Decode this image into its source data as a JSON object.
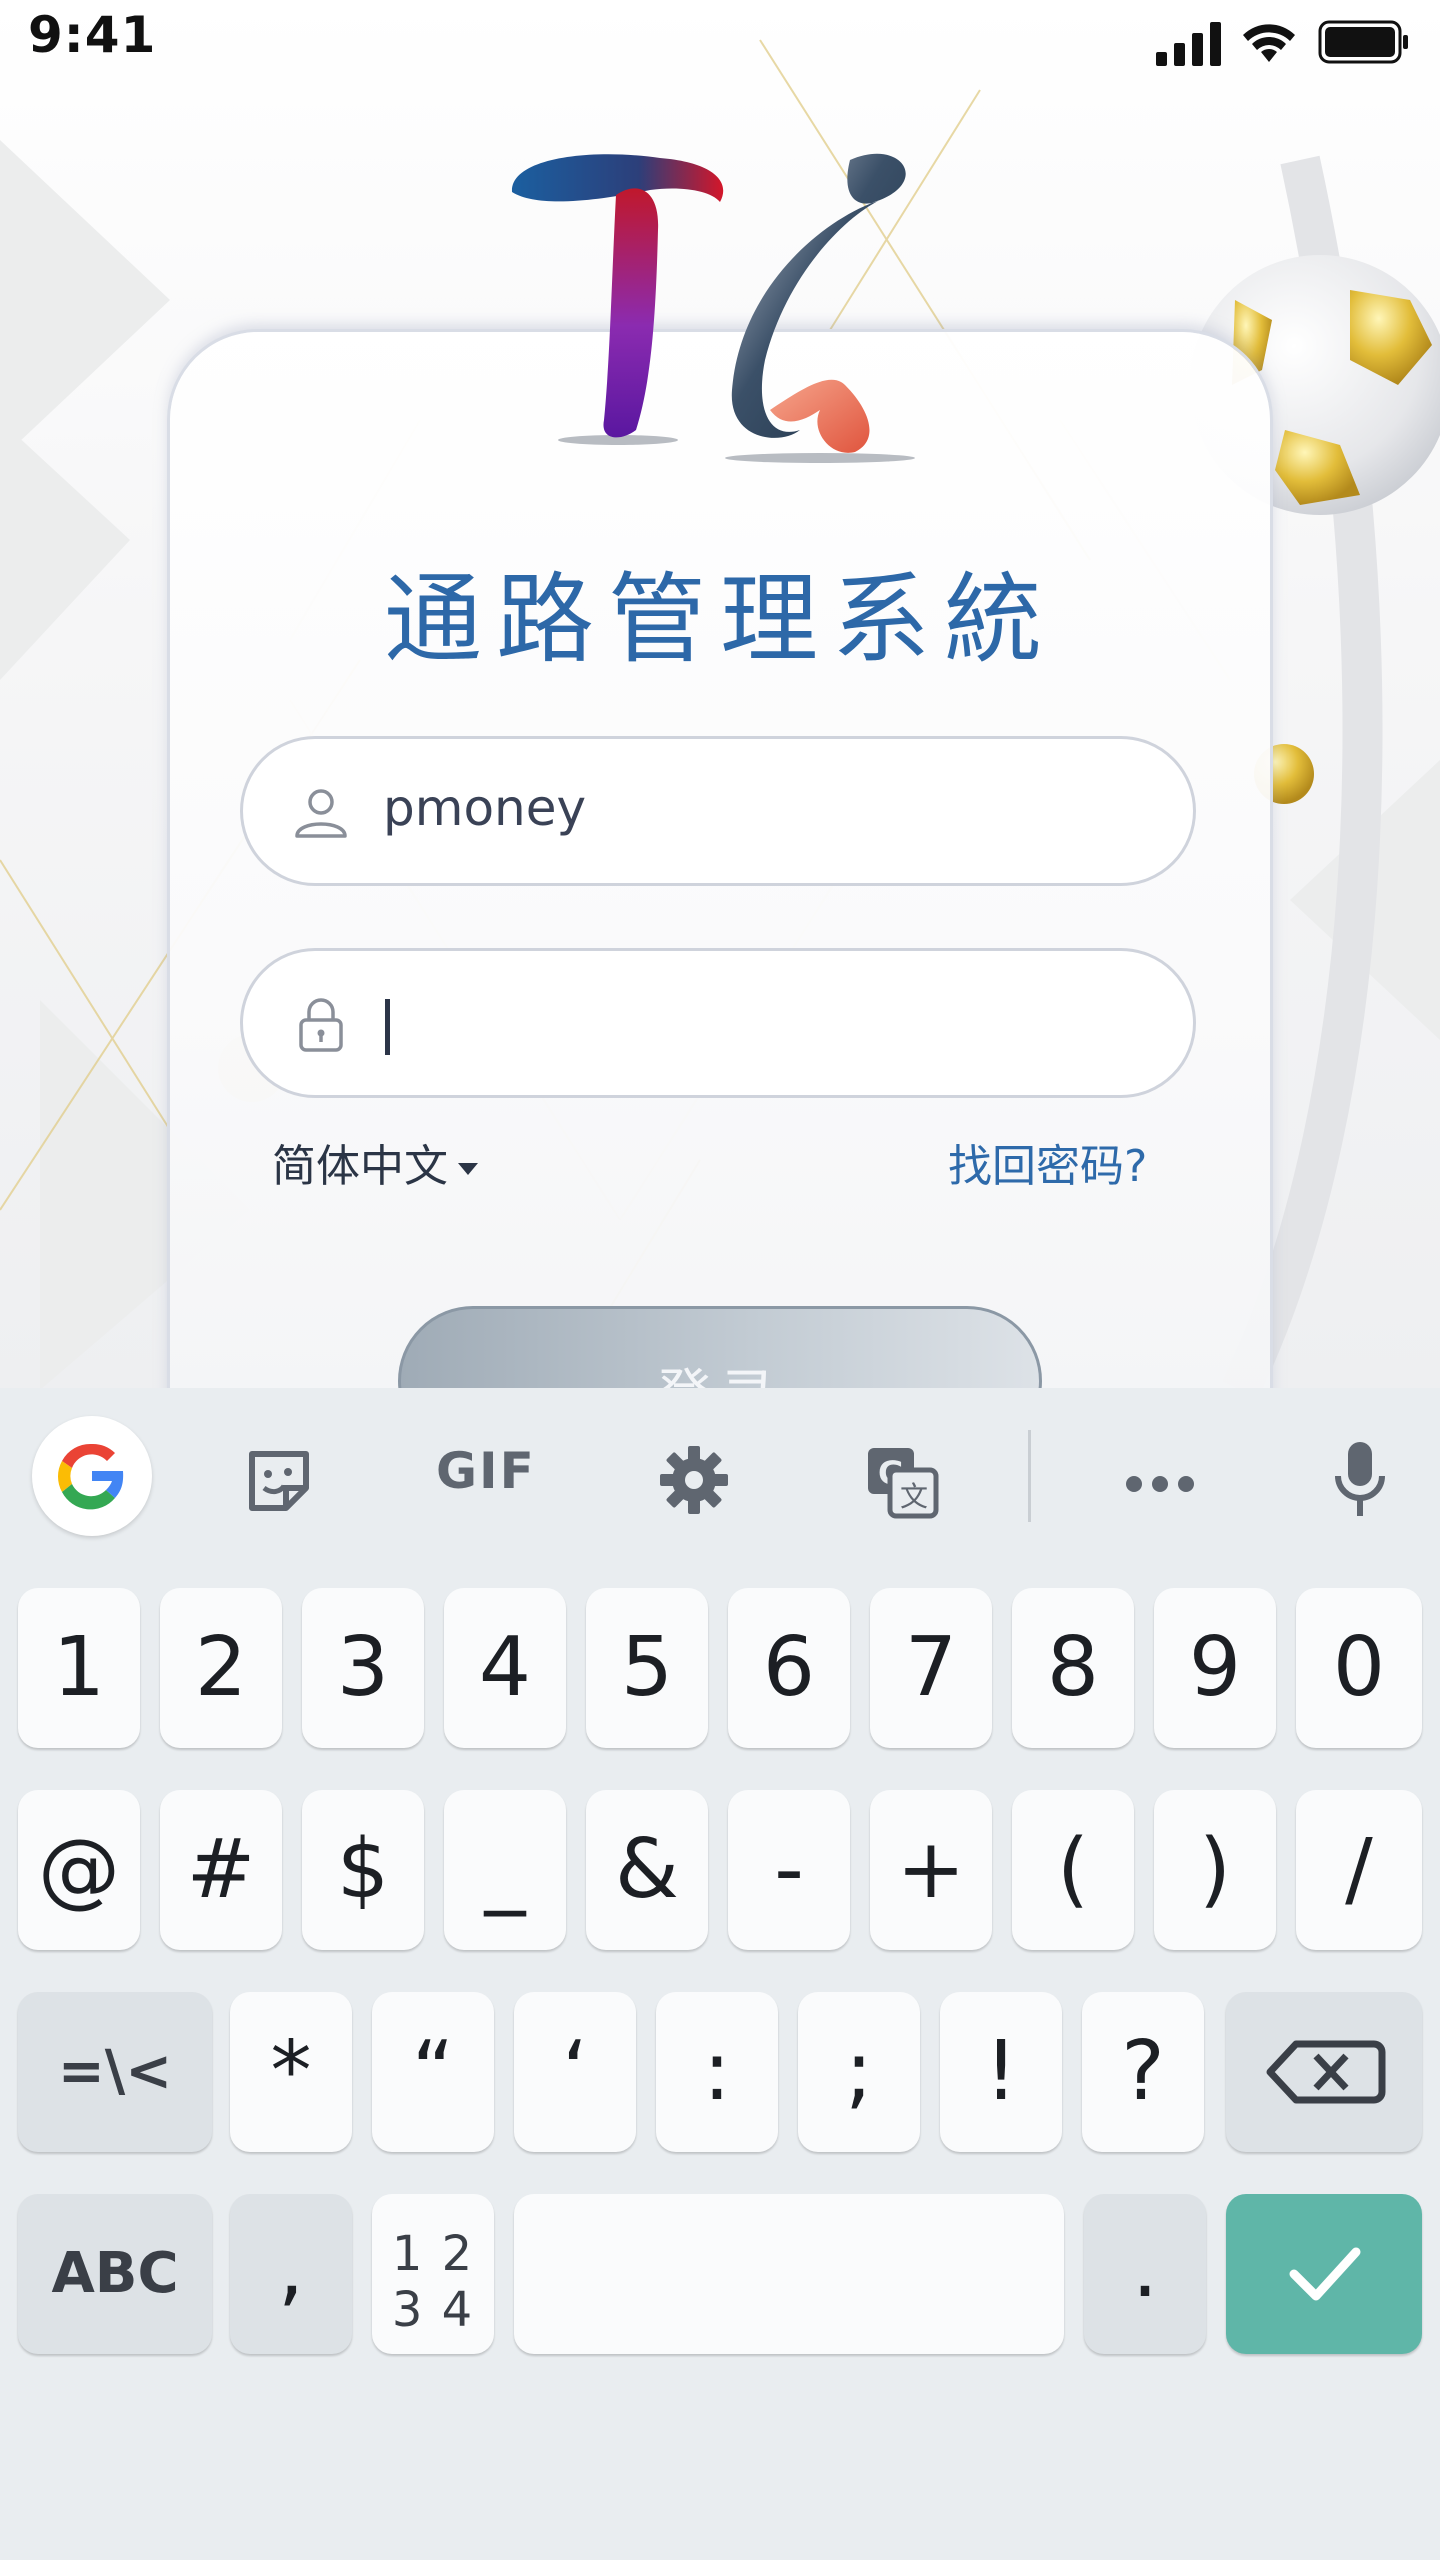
{
  "status_bar": {
    "time": "9:41"
  },
  "app": {
    "title": "通路管理系統"
  },
  "form": {
    "username_value": "pmoney",
    "password_value": "",
    "language_label": "简体中文",
    "forgot_label": "找回密码?",
    "login_label": "登录"
  },
  "keyboard": {
    "toolbar": {
      "items": [
        "google-icon",
        "sticker-icon",
        "GIF",
        "gear-icon",
        "translate-icon",
        "more-icon",
        "mic-icon"
      ],
      "gif_label": "GIF"
    },
    "row1": [
      "1",
      "2",
      "3",
      "4",
      "5",
      "6",
      "7",
      "8",
      "9",
      "0"
    ],
    "row2": [
      "@",
      "#",
      "$",
      "_",
      "&",
      "-",
      "+",
      "(",
      ")",
      "/"
    ],
    "row3": [
      "=\\<",
      "*",
      "“",
      "‘",
      ":",
      ";",
      "!",
      "?"
    ],
    "row4": {
      "abc": "ABC",
      "comma": ",",
      "numpad_top": "1 2",
      "numpad_bottom": "3 4",
      "period": "."
    }
  },
  "colors": {
    "title": "#2d68a8",
    "enter": "#5fb6a8",
    "link": "#2e6aaa"
  }
}
